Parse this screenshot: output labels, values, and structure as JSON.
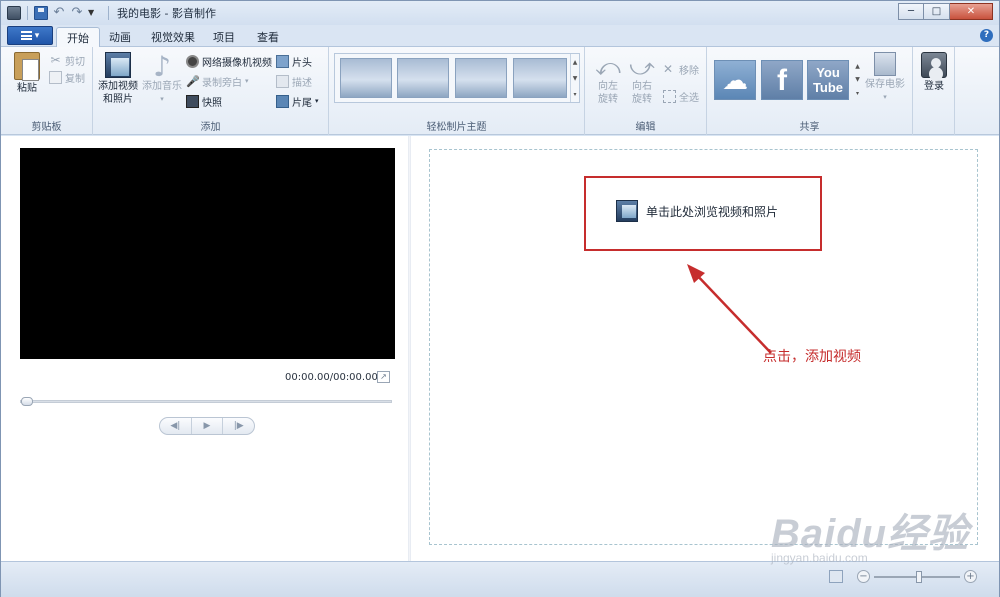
{
  "window": {
    "title": "我的电影 - 影音制作",
    "controls": {
      "minimize": "─",
      "maximize": "□",
      "close": "✕"
    }
  },
  "tabs": [
    {
      "label": "开始",
      "active": true
    },
    {
      "label": "动画",
      "active": false
    },
    {
      "label": "视觉效果",
      "active": false
    },
    {
      "label": "项目",
      "active": false
    },
    {
      "label": "查看",
      "active": false
    }
  ],
  "ribbon": {
    "clipboard": {
      "label": "剪贴板",
      "paste": "粘贴",
      "cut": "剪切",
      "copy": "复制"
    },
    "add": {
      "label": "添加",
      "add_videos_line1": "添加视频",
      "add_videos_line2": "和照片",
      "add_music": "添加音乐",
      "webcam": "网络摄像机视频",
      "narration": "录制旁白",
      "snapshot": "快照",
      "title": "片头",
      "caption": "描述",
      "credits": "片尾"
    },
    "themes": {
      "label": "轻松制片主题"
    },
    "editing": {
      "label": "编辑",
      "rotate_left_1": "向左",
      "rotate_left_2": "旋转",
      "rotate_right_1": "向右",
      "rotate_right_2": "旋转",
      "remove": "移除",
      "select_all": "全选"
    },
    "share": {
      "label": "共享",
      "skydrive_icon": "cloud-icon",
      "facebook_text": "f",
      "youtube_line1": "You",
      "youtube_line2": "Tube",
      "save_movie": "保存电影"
    },
    "signin": "登录"
  },
  "preview": {
    "timecode": "00:00.00/00:00.00",
    "controls": {
      "prev": "◀|",
      "play": "▶",
      "next": "|▶"
    },
    "seek_position": 0
  },
  "storyboard": {
    "browse_text": "单击此处浏览视频和照片",
    "annotation": "点击，添加视频"
  },
  "statusbar": {
    "zoom_minus": "−",
    "zoom_plus": "+",
    "zoom_level": 0.53
  },
  "watermark": {
    "logo": "Baidu经验",
    "site": "jingyan.baidu.com"
  },
  "colors": {
    "accent": "#1f55a8",
    "annotation_red": "#c62d2d",
    "storyboard_border": "#a8c4cf"
  }
}
